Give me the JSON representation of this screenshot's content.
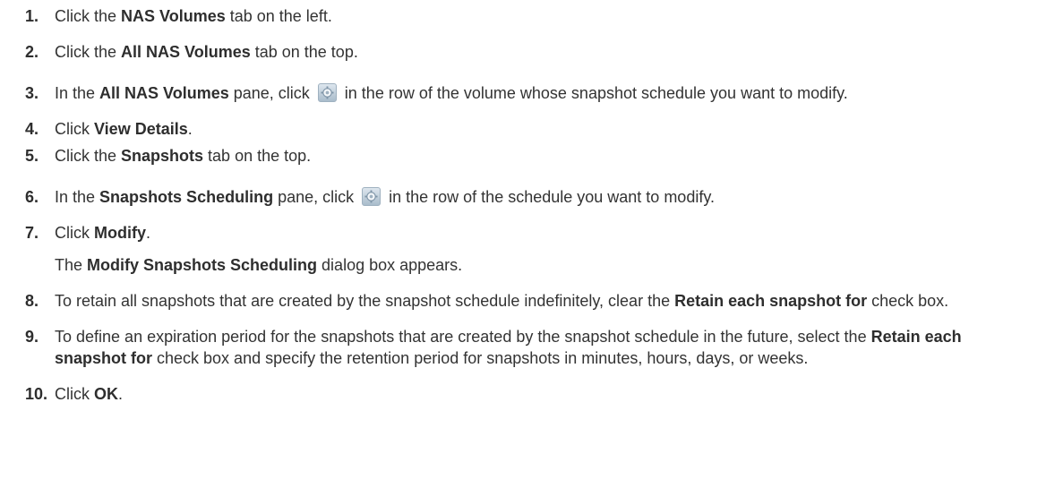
{
  "steps": [
    {
      "n": "1.",
      "pre": "Click the ",
      "b1": "NAS Volumes",
      "post": " tab on the left."
    },
    {
      "n": "2.",
      "pre": "Click the ",
      "b1": "All NAS Volumes",
      "post": " tab on the top."
    },
    {
      "n": "3.",
      "pre": "In the ",
      "b1": "All NAS Volumes",
      "mid": " pane, click ",
      "post": " in the row of the volume whose snapshot schedule you want to modify.",
      "icon": "gear-icon"
    },
    {
      "n": "4.",
      "pre": "Click ",
      "b1": "View Details",
      "post": "."
    },
    {
      "n": "5.",
      "pre": "Click the ",
      "b1": "Snapshots",
      "post": " tab on the top."
    },
    {
      "n": "6.",
      "pre": "In the ",
      "b1": "Snapshots Scheduling",
      "mid": " pane, click ",
      "post": " in the row of the schedule you want to modify.",
      "icon": "gear-icon"
    },
    {
      "n": "7.",
      "pre": "Click ",
      "b1": "Modify",
      "post": ".",
      "note_b": "Modify Snapshots Scheduling",
      "note_post": " dialog box appears.",
      "note_pre": "The "
    },
    {
      "n": "8.",
      "pre": "To retain all snapshots that are created by the snapshot schedule indefinitely, clear the ",
      "b1": "Retain each snapshot for",
      "post": " check box."
    },
    {
      "n": "9.",
      "pre": "To define an expiration period for the snapshots that are created by the snapshot schedule in the future, select the ",
      "b1": "Retain each snapshot for",
      "post": " check box and specify the retention period for snapshots in minutes, hours, days, or weeks."
    },
    {
      "n": "10.",
      "pre": "Click ",
      "b1": "OK",
      "post": "."
    }
  ]
}
